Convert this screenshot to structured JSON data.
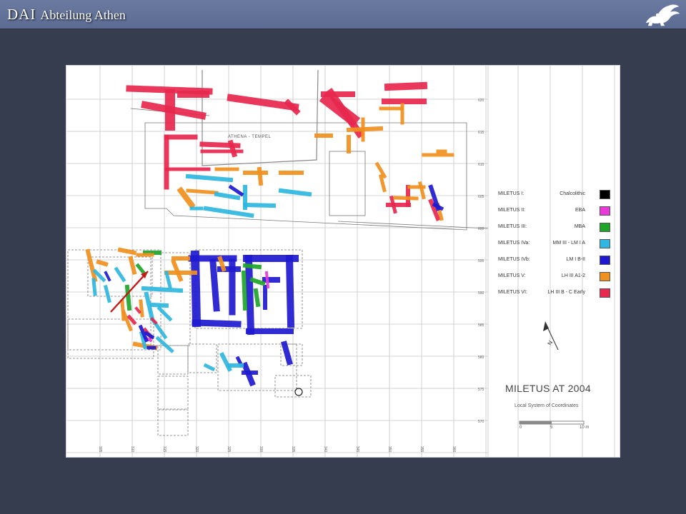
{
  "header": {
    "brand_main": "DAI",
    "brand_sub": "Abteilung Athen",
    "logo_icon": "griffin-logo-icon"
  },
  "map": {
    "title": "MILETUS AT 2004",
    "subtitle": "Local System of Coordinates",
    "temple_label": "ATHENA - TEMPEL",
    "north_label": "N",
    "scale": [
      "0",
      "5",
      "10 m"
    ],
    "legend": [
      {
        "name": "MILETUS I:",
        "period": "Chalcolithic",
        "color": "#000000"
      },
      {
        "name": "MILETUS II:",
        "period": "EBA",
        "color": "#e83ad8"
      },
      {
        "name": "MILETUS III:",
        "period": "MBA",
        "color": "#1fa52a"
      },
      {
        "name": "MILETUS IVa:",
        "period": "MM III - LM I A",
        "color": "#2eb7e0"
      },
      {
        "name": "MILETUS IVb:",
        "period": "LM I B-II",
        "color": "#1f1ad0"
      },
      {
        "name": "MILETUS V:",
        "period": "LH III A1-2",
        "color": "#f0901e"
      },
      {
        "name": "MILETUS VI:",
        "period": "LH III B - C Early",
        "color": "#e8284e"
      }
    ],
    "axis_right": [
      "620",
      "615",
      "610",
      "605",
      "600",
      "595",
      "590",
      "585",
      "580",
      "575",
      "570"
    ],
    "axis_bottom": [
      "305",
      "310",
      "315",
      "320",
      "325",
      "330",
      "335",
      "340",
      "345",
      "350",
      "355",
      "360"
    ]
  }
}
